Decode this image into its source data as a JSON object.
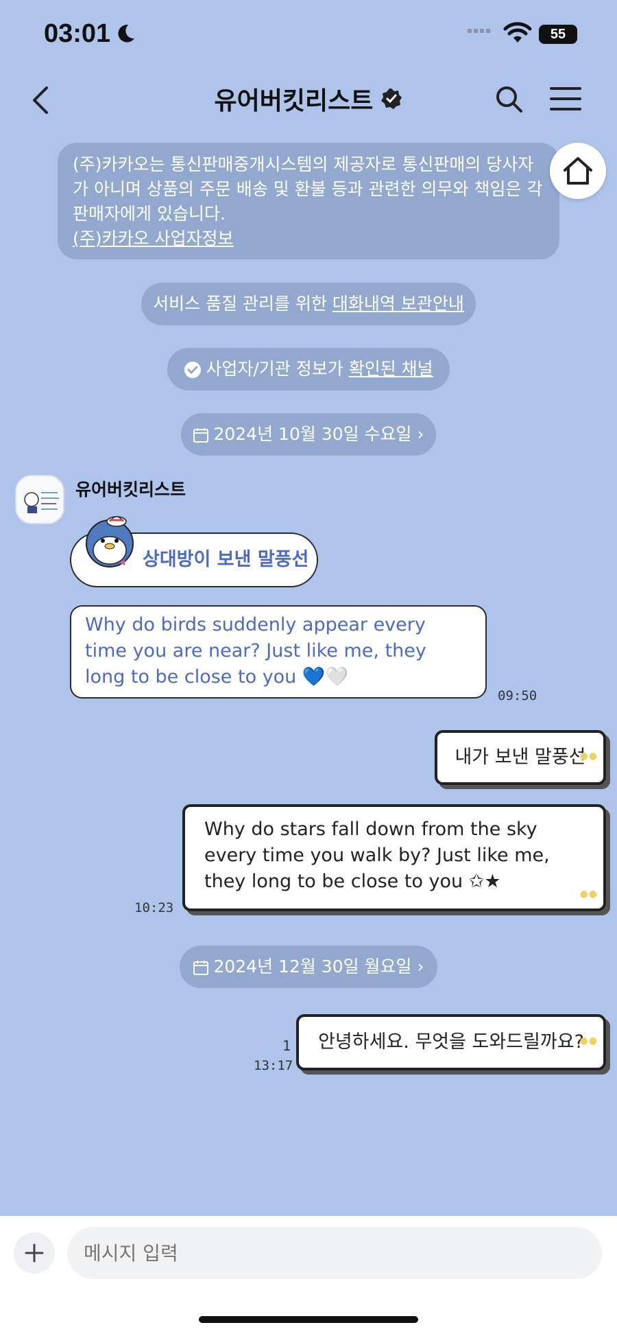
{
  "status_bar": {
    "time": "03:01",
    "battery": "55"
  },
  "header": {
    "title": "유어버킷리스트"
  },
  "notice": {
    "text": "(주)카카오는 통신판매중개시스템의 제공자로 통신판매의 당사자가 아니며 상품의 주문 배송 및 환불 등과 관련한 의무와 책임은 각 판매자에게 있습니다.",
    "link": "(주)카카오 사업자정보"
  },
  "info_pills": {
    "storage_prefix": "서비스 품질 관리를 위한 ",
    "storage_link": "대화내역 보관안내",
    "verified_prefix": "사업자/기관 정보가 ",
    "verified_link": "확인된 채널"
  },
  "date_dividers": [
    "2024년 10월 30일 수요일",
    "2024년 12월 30일 월요일"
  ],
  "messages": {
    "sender_name": "유어버킷리스트",
    "in_1": "상대방이 보낸 말풍선",
    "in_2": "Why do birds suddenly appear every time you are near? Just like me, they long to be close to you 💙🤍",
    "in_time": "09:50",
    "out_1": "내가 보낸 말풍선",
    "out_2": "Why do stars fall down from the sky every time you walk by? Just like me, they long to be close to you ✩★",
    "out_time": "10:23",
    "out_3": "안녕하세요. 무엇을 도와드릴까요?",
    "out_3_unread": "1",
    "out_3_time": "13:17"
  },
  "input": {
    "placeholder": "메시지 입력"
  }
}
